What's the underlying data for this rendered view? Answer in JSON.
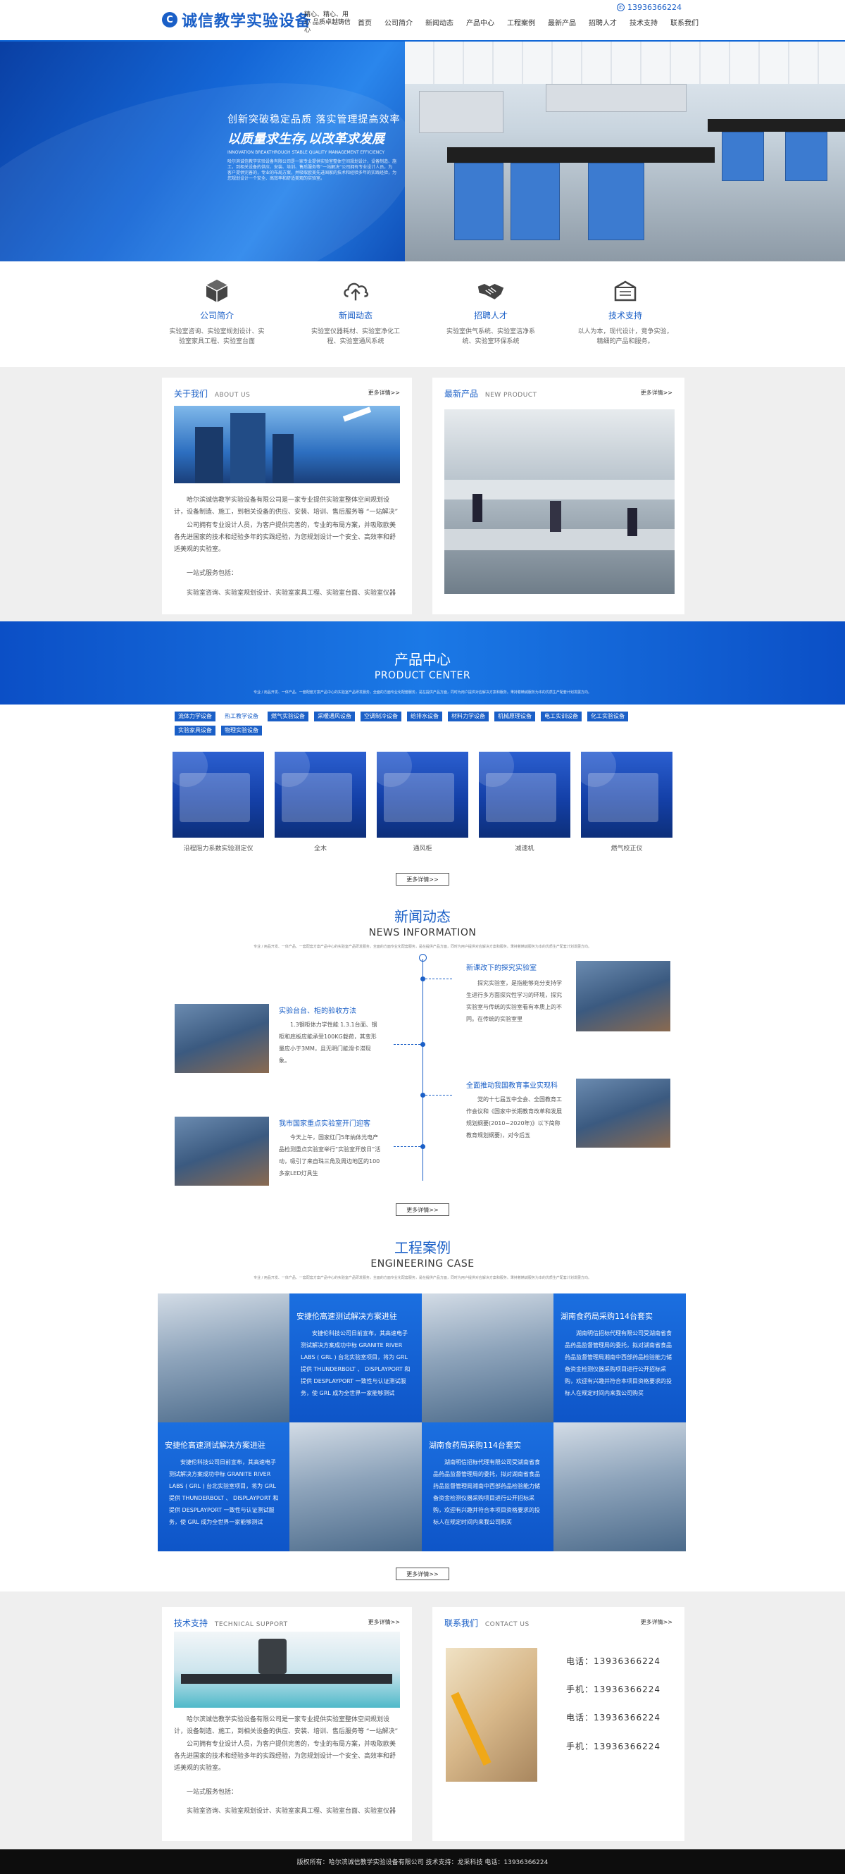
{
  "header": {
    "logo_mark": "C",
    "logo_text": "诚信教学实验设备",
    "slogan": "精心、精心、用心 品质卓越铸信心",
    "nav": [
      "首页",
      "公司简介",
      "新闻动态",
      "产品中心",
      "工程案例",
      "最新产品",
      "招聘人才",
      "技术支持",
      "联系我们"
    ],
    "phone": "13936366224"
  },
  "banner": {
    "line1": "创新突破稳定品质  落实管理提高效率",
    "line2": "以质量求生存,以改革求发展",
    "line3": "INNOVATION BREAKTHROUGH STABLE QUALITY MANAGEMENT EFFICIENCY",
    "para": "哈尔滨诚信教学实验设备有限公司是一家专业提供实验室整体空间规划设计，设备制造、施工，到相关设备的供应、安装、培训、售后服务等“一站解决”公司拥有专业设计人员，为客户提供完善的，专业的布局方案，并吸取欧美先进国家的技术和经验多年的实践经验，为您规划设计一个安全、高效率和舒适美观的实验室。"
  },
  "features": [
    {
      "icon": "cube-icon",
      "title": "公司简介",
      "desc": "实验室咨询、实验室规划设计、实验室家具工程、实验室台面"
    },
    {
      "icon": "cloud-upload-icon",
      "title": "新闻动态",
      "desc": "实验室仪器耗材、实验室净化工程、实验室通风系统"
    },
    {
      "icon": "handshake-icon",
      "title": "招聘人才",
      "desc": "实验室供气系统、实验室洁净系统、实验室环保系统"
    },
    {
      "icon": "box-open-icon",
      "title": "技术支持",
      "desc": "以人为本，现代设计，竞争实验，精细的产品和服务。"
    }
  ],
  "about": {
    "title": "关于我们",
    "sub": "ABOUT US",
    "more": "更多详情>>",
    "p1": "哈尔滨诚信教学实验设备有限公司是一家专业提供实验室整体空间规划设计，设备制造、施工，到相关设备的供应、安装、培训、售后服务等 “一站解决”",
    "p2": "公司拥有专业设计人员，为客户提供完善的，专业的布局方案，并吸取欧美各先进国家的技术和经验多年的实践经验，为您规划设计一个安全、高效率和舒适美观的实验室。",
    "p3": "一站式服务包括：",
    "p4": "实验室咨询、实验室规划设计、实验室家具工程、实验室台面、实验室仪器"
  },
  "latest": {
    "title": "最新产品",
    "sub": "NEW PRODUCT",
    "more": "更多详情>>"
  },
  "product_center": {
    "title": "产品中心",
    "sub": "PRODUCT CENTER",
    "desc": "专业 / 用品开发、一体产品、一套配套方案产品中心的实验室产品研发服务，全面的方面专业化配套服务，是在提供产品方面，同时为用户提供对应解决方案和服务。秉持着精诚服务为本的优质生产配套计划发展方向。",
    "tabs": [
      "流体力学设备",
      "热工教学设备",
      "燃气实验设备",
      "采暖通风设备",
      "空调制冷设备",
      "给排水设备",
      "材料力学设备",
      "机械原理设备",
      "电工实训设备",
      "化工实验设备",
      "实验家具设备",
      "物理实验设备"
    ],
    "active_tab": 1,
    "products": [
      "沿程阻力系数实验测定仪",
      "全木",
      "通风柜",
      "减速机",
      "燃气校正仪"
    ],
    "more": "更多详情>>"
  },
  "news": {
    "title": "新闻动态",
    "sub": "NEWS INFORMATION",
    "desc": "专业 / 用品开发、一体产品、一套配套方案产品中心的实验室产品研发服务，全面的方面专业化配套服务，是在提供产品方面，同时为用户提供对应解决方案和服务。秉持着精诚服务为本的优质生产配套计划发展方向。",
    "items": [
      {
        "title": "新课改下的探究实验室",
        "body": "探究实验室，是指能够充分支持学生进行多方面探究性学习的环境，探究实验室与传统的实验室看有本质上的不同。在传统的实验室里"
      },
      {
        "title": "实验台台、柜的验收方法",
        "body": "1.3钢柜体力学性能 1.3.1台面、钢柜和底板应能承受100KG载荷，其变形量应小于3MM，且无明门能滑卡滞现象。"
      },
      {
        "title": "全面推动我国教育事业实现科",
        "body": "党的十七届五中全会、全国教育工作会议和《国家中长期教育改革和发展规划纲要(2010~2020年)》以下简称教育规划纲要)，对今后五"
      },
      {
        "title": "我市国家重点实验室开门迎客",
        "body": "今天上午，国家红门5年纳体光电产品检测重点实验室举行“实验室开放日”活动，吸引了来自珠三角及周边地区的100多家LED灯具生"
      }
    ],
    "more": "更多详情>>"
  },
  "engineering": {
    "title": "工程案例",
    "sub": "ENGINEERING CASE",
    "desc": "专业 / 用品开发、一体产品、一套配套方案产品中心的实验室产品研发服务，全面的方面专业化配套服务，是在提供产品方面，同时为用户提供对应解决方案和服务。秉持着精诚服务为本的优质生产配套计划发展方向。",
    "cases": [
      {
        "title": "安捷伦高速测试解决方案进驻",
        "body": "安捷伦科技公司日前宣布，其高速电子测试解决方案成功中标 GRANITE RIVER LABS ( GRL ) 台北实验室项目，将为 GRL 提供 THUNDERBOLT 、 DISPLAYPORT 和 提供 DESPLAYPORT 一致性与认证测试服务，使 GRL 成为全世界一家能够测试"
      },
      {
        "title": "湖南食药局采购114台套实",
        "body": "湖南明信招标代理有限公司受湖南省食品药品监督管理局的委托，拟对湖南省食品药品监督管理局湘南中西部药品检验能力储备资金检测仪器采购项目进行公开招标采购，欢迎有兴趣并符合本项目资格要求的投标人在规定时间内来我公司购买"
      },
      {
        "title": "安捷伦高速测试解决方案进驻",
        "body": "安捷伦科技公司日前宣布，其高速电子测试解决方案成功中标 GRANITE RIVER LABS ( GRL ) 台北实验室项目，将为 GRL 提供 THUNDERBOLT 、 DISPLAYPORT 和 提供 DESPLAYPORT 一致性与认证测试服务，使 GRL 成为全世界一家能够测试"
      },
      {
        "title": "湖南食药局采购114台套实",
        "body": "湖南明信招标代理有限公司受湖南省食品药品监督管理局的委托，拟对湖南省食品药品监督管理局湘南中西部药品检验能力储备资金检测仪器采购项目进行公开招标采购，欢迎有兴趣并符合本项目资格要求的投标人在规定时间内来我公司购买"
      }
    ],
    "more": "更多详情>>"
  },
  "tech": {
    "title": "技术支持",
    "sub": "TECHNICAL SUPPORT",
    "more": "更多详情>>",
    "p1": "哈尔滨诚信教学实验设备有限公司是一家专业提供实验室整体空间规划设计，设备制造、施工，到相关设备的供应、安装、培训、售后服务等 “一站解决”",
    "p2": "公司拥有专业设计人员，为客户提供完善的，专业的布局方案，并吸取欧美各先进国家的技术和经验多年的实践经验，为您规划设计一个安全、高效率和舒适美观的实验室。",
    "p3": "一站式服务包括：",
    "p4": "实验室咨询、实验室规划设计、实验室家具工程、实验室台面、实验室仪器"
  },
  "contact": {
    "title": "联系我们",
    "sub": "CONTACT US",
    "more": "更多详情>>",
    "lines": [
      "电话：13936366224",
      "手机：13936366224",
      "电话：13936366224",
      "手机：13936366224"
    ]
  },
  "footer": "版权所有：哈尔滨诚信教学实验设备有限公司   技术支持：龙采科技   电话：13936366224",
  "colors": {
    "accent": "#1a5fc7",
    "footer": "#0d0d0d",
    "band": "#efefef"
  }
}
